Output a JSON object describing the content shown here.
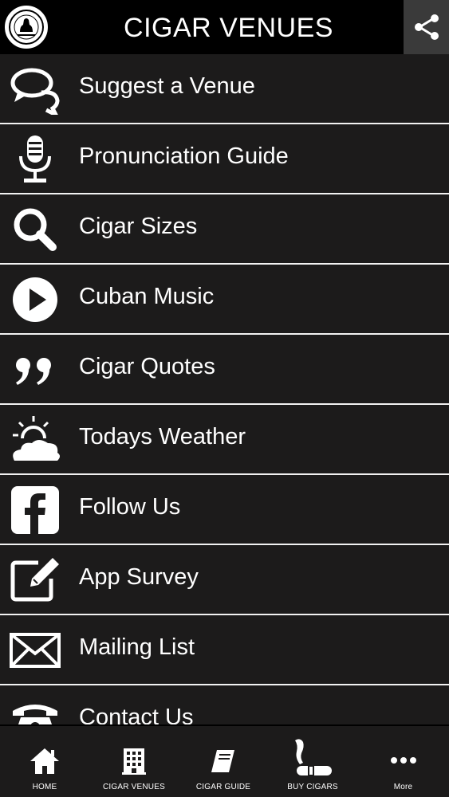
{
  "header": {
    "title": "CIGAR VENUES",
    "logo_icon": "cigar-club-logo",
    "share_icon": "share-icon"
  },
  "menu": {
    "items": [
      {
        "label": "Suggest a Venue",
        "icon": "speech-bubbles-icon"
      },
      {
        "label": "Pronunciation Guide",
        "icon": "microphone-icon"
      },
      {
        "label": "Cigar Sizes",
        "icon": "search-icon"
      },
      {
        "label": "Cuban Music",
        "icon": "play-icon"
      },
      {
        "label": "Cigar Quotes",
        "icon": "quote-icon"
      },
      {
        "label": "Todays Weather",
        "icon": "weather-icon"
      },
      {
        "label": "Follow Us",
        "icon": "facebook-icon"
      },
      {
        "label": "App Survey",
        "icon": "edit-icon"
      },
      {
        "label": "Mailing List",
        "icon": "envelope-icon"
      },
      {
        "label": "Contact Us",
        "icon": "phone-icon"
      }
    ]
  },
  "tabbar": {
    "tabs": [
      {
        "label": "HOME",
        "icon": "home-icon"
      },
      {
        "label": "CIGAR VENUES",
        "icon": "building-icon"
      },
      {
        "label": "CIGAR GUIDE",
        "icon": "book-icon"
      },
      {
        "label": "BUY CIGARS",
        "icon": "cigar-icon"
      },
      {
        "label": "More",
        "icon": "more-icon"
      }
    ]
  },
  "colors": {
    "background": "#1c1b1b",
    "header": "#000000",
    "divider": "#f2f2f2",
    "text": "#ffffff",
    "share_button": "#3a3a3a"
  }
}
